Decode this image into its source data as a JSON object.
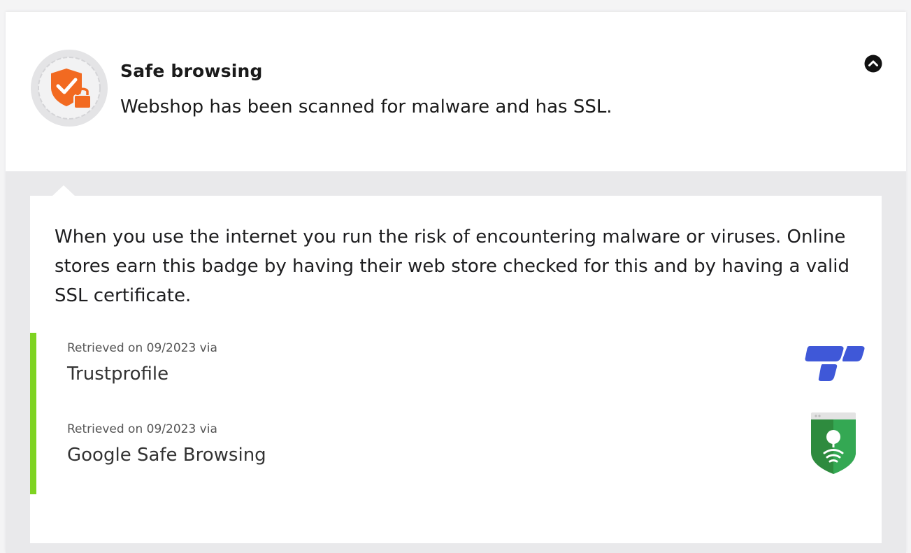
{
  "header": {
    "title": "Safe browsing",
    "subtitle": "Webshop has been scanned for malware and has SSL.",
    "badge_icon": "shield-check-lock-icon",
    "collapse_icon": "chevron-up-icon"
  },
  "details": {
    "description": "When you use the internet you run the risk of encountering malware or viruses. Online stores earn this badge by having their web store checked for this and by having a valid SSL certificate.",
    "sources": [
      {
        "meta": "Retrieved on 09/2023 via",
        "name": "Trustprofile",
        "logo_icon": "trustprofile-logo"
      },
      {
        "meta": "Retrieved on 09/2023 via",
        "name": "Google Safe Browsing",
        "logo_icon": "google-safe-browsing-logo"
      }
    ]
  },
  "colors": {
    "accent_orange": "#f26a21",
    "accent_green": "#7ed321",
    "trustprofile_blue": "#3f58d8",
    "google_green": "#34a853"
  }
}
